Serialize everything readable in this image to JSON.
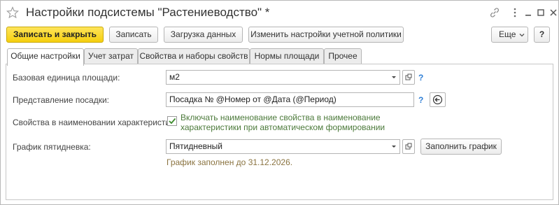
{
  "window": {
    "title": "Настройки подсистемы \"Растениеводство\" *"
  },
  "toolbar": {
    "save_close_label": "Записать и закрыть",
    "save_label": "Записать",
    "load_data_label": "Загрузка данных",
    "change_policy_label": "Изменить настройки учетной политики",
    "more_label": "Еще",
    "help_label": "?"
  },
  "tabs": [
    {
      "label": "Общие настройки"
    },
    {
      "label": "Учет затрат"
    },
    {
      "label": "Свойства и наборы свойств"
    },
    {
      "label": "Нормы площади"
    },
    {
      "label": "Прочее"
    }
  ],
  "form": {
    "area_unit": {
      "label": "Базовая единица площади:",
      "value": "м2",
      "help": "?"
    },
    "planting_repr": {
      "label": "Представление посадки:",
      "value": "Посадка № @Номер от @Дата (@Период)",
      "help": "?"
    },
    "props_in_name": {
      "label": "Свойства в наименовании характеристик:",
      "checked": true,
      "text": "Включать наименование свойства в наименование характеристики при автоматическом формировании"
    },
    "schedule": {
      "label": "График пятидневка:",
      "value": "Пятидневный",
      "fill_button": "Заполнить график",
      "hint": "График заполнен до 31.12.2026."
    }
  }
}
